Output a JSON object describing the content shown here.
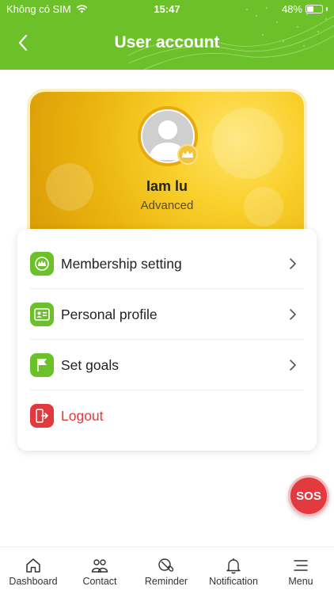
{
  "status_bar": {
    "carrier": "Không có SIM",
    "time": "15:47",
    "battery": "48%",
    "battery_level": 0.48
  },
  "header": {
    "title": "User account"
  },
  "profile": {
    "name": "Iam lu",
    "level": "Advanced"
  },
  "menu": {
    "items": [
      {
        "label": "Membership setting",
        "icon": "crown-icon",
        "color": "#6cc12a"
      },
      {
        "label": "Personal profile",
        "icon": "id-card-icon",
        "color": "#6cc12a"
      },
      {
        "label": "Set goals",
        "icon": "flag-icon",
        "color": "#6cc12a"
      },
      {
        "label": "Logout",
        "icon": "logout-icon",
        "color": "#e0393e"
      }
    ]
  },
  "sos": {
    "label": "SOS"
  },
  "bottom_nav": {
    "items": [
      {
        "label": "Dashboard",
        "icon": "home-icon"
      },
      {
        "label": "Contact",
        "icon": "contacts-icon"
      },
      {
        "label": "Reminder",
        "icon": "pill-icon"
      },
      {
        "label": "Notification",
        "icon": "bell-icon"
      },
      {
        "label": "Menu",
        "icon": "menu-icon"
      }
    ]
  },
  "colors": {
    "brand_green": "#6cc12a",
    "logout_red": "#e0393e",
    "gold": "#f2c51c"
  }
}
